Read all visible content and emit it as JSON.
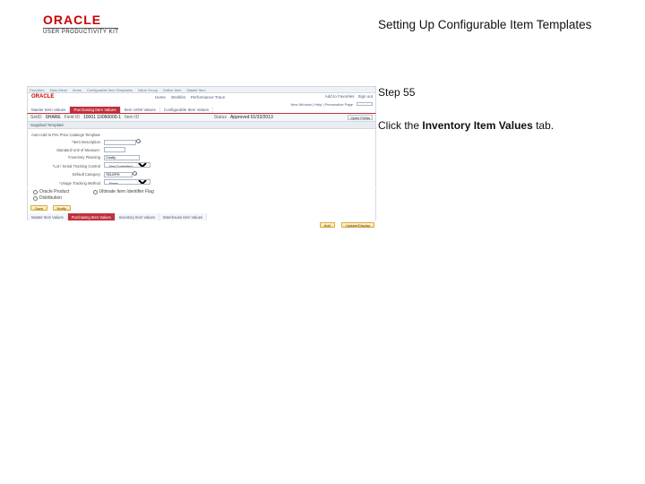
{
  "header": {
    "brand": "ORACLE",
    "brand_sub": "USER PRODUCTIVITY KIT",
    "title": "Setting Up Configurable Item Templates"
  },
  "side": {
    "step_label": "Step 55",
    "instruction_pre": "Click the ",
    "instruction_bold": "Inventory Item Values",
    "instruction_post": " tab."
  },
  "shot": {
    "browser": {
      "items": [
        "Favorites",
        "Main Menu",
        "Items",
        "Configurable Item Templates",
        "Value Group",
        "Define Item",
        "Master Item"
      ]
    },
    "brand": "ORACLE",
    "nav_links": [
      "Home",
      "Worklist",
      "Performance Trace",
      "Add to Favorites",
      "Sign out"
    ],
    "subnav_label": "New Window | Help | Personalize Page",
    "top_tabs": {
      "t0": "Master Item Values",
      "t1": "Purchasing Item Values",
      "t2": "Item UOM Values",
      "t3": "Configurable Item Values"
    },
    "info": {
      "setid_label": "SetID",
      "setid_value": "SHARE",
      "field_id_label": "Field ID",
      "field_id_value": "10001 10060000-1",
      "item_label": "Item ID",
      "status_label": "Status",
      "status_value": "Approved 01/22/2013",
      "buttons": {
        "open": "Open Fields"
      }
    },
    "section": "Supplied Template",
    "form": {
      "auto_label": "Auto-Add to Priv Price Catalogs Template",
      "desc_label": "*Item Description",
      "desc_value": "",
      "std_label": "Standard Unit of Measure:",
      "std_value": "",
      "plan_label": "*Inventory Planning",
      "plan_value": "Costly",
      "trace1_label": "*Lot / Serial Tracking Control",
      "trace1_value": "Not Controlled",
      "cat_label": "Default Category",
      "cat_value": "TELEPH",
      "trace2_label": "*Usage Tracking Method",
      "trace2_value": "None"
    },
    "checks": {
      "c0": "Oracle Product",
      "c1": "Distribution",
      "c2": "Ultimate Item Identifier Flag"
    },
    "lower_buttons": {
      "save": "Save",
      "notify": "Notify"
    },
    "float_buttons": {
      "add": "Add",
      "update": "Update/Display"
    },
    "bottom_tabs": {
      "t0": "Master Item Values",
      "t1": "Purchasing Item Values",
      "t2": "Inventory Item Values",
      "t3": "Warehouse Item Values"
    }
  }
}
